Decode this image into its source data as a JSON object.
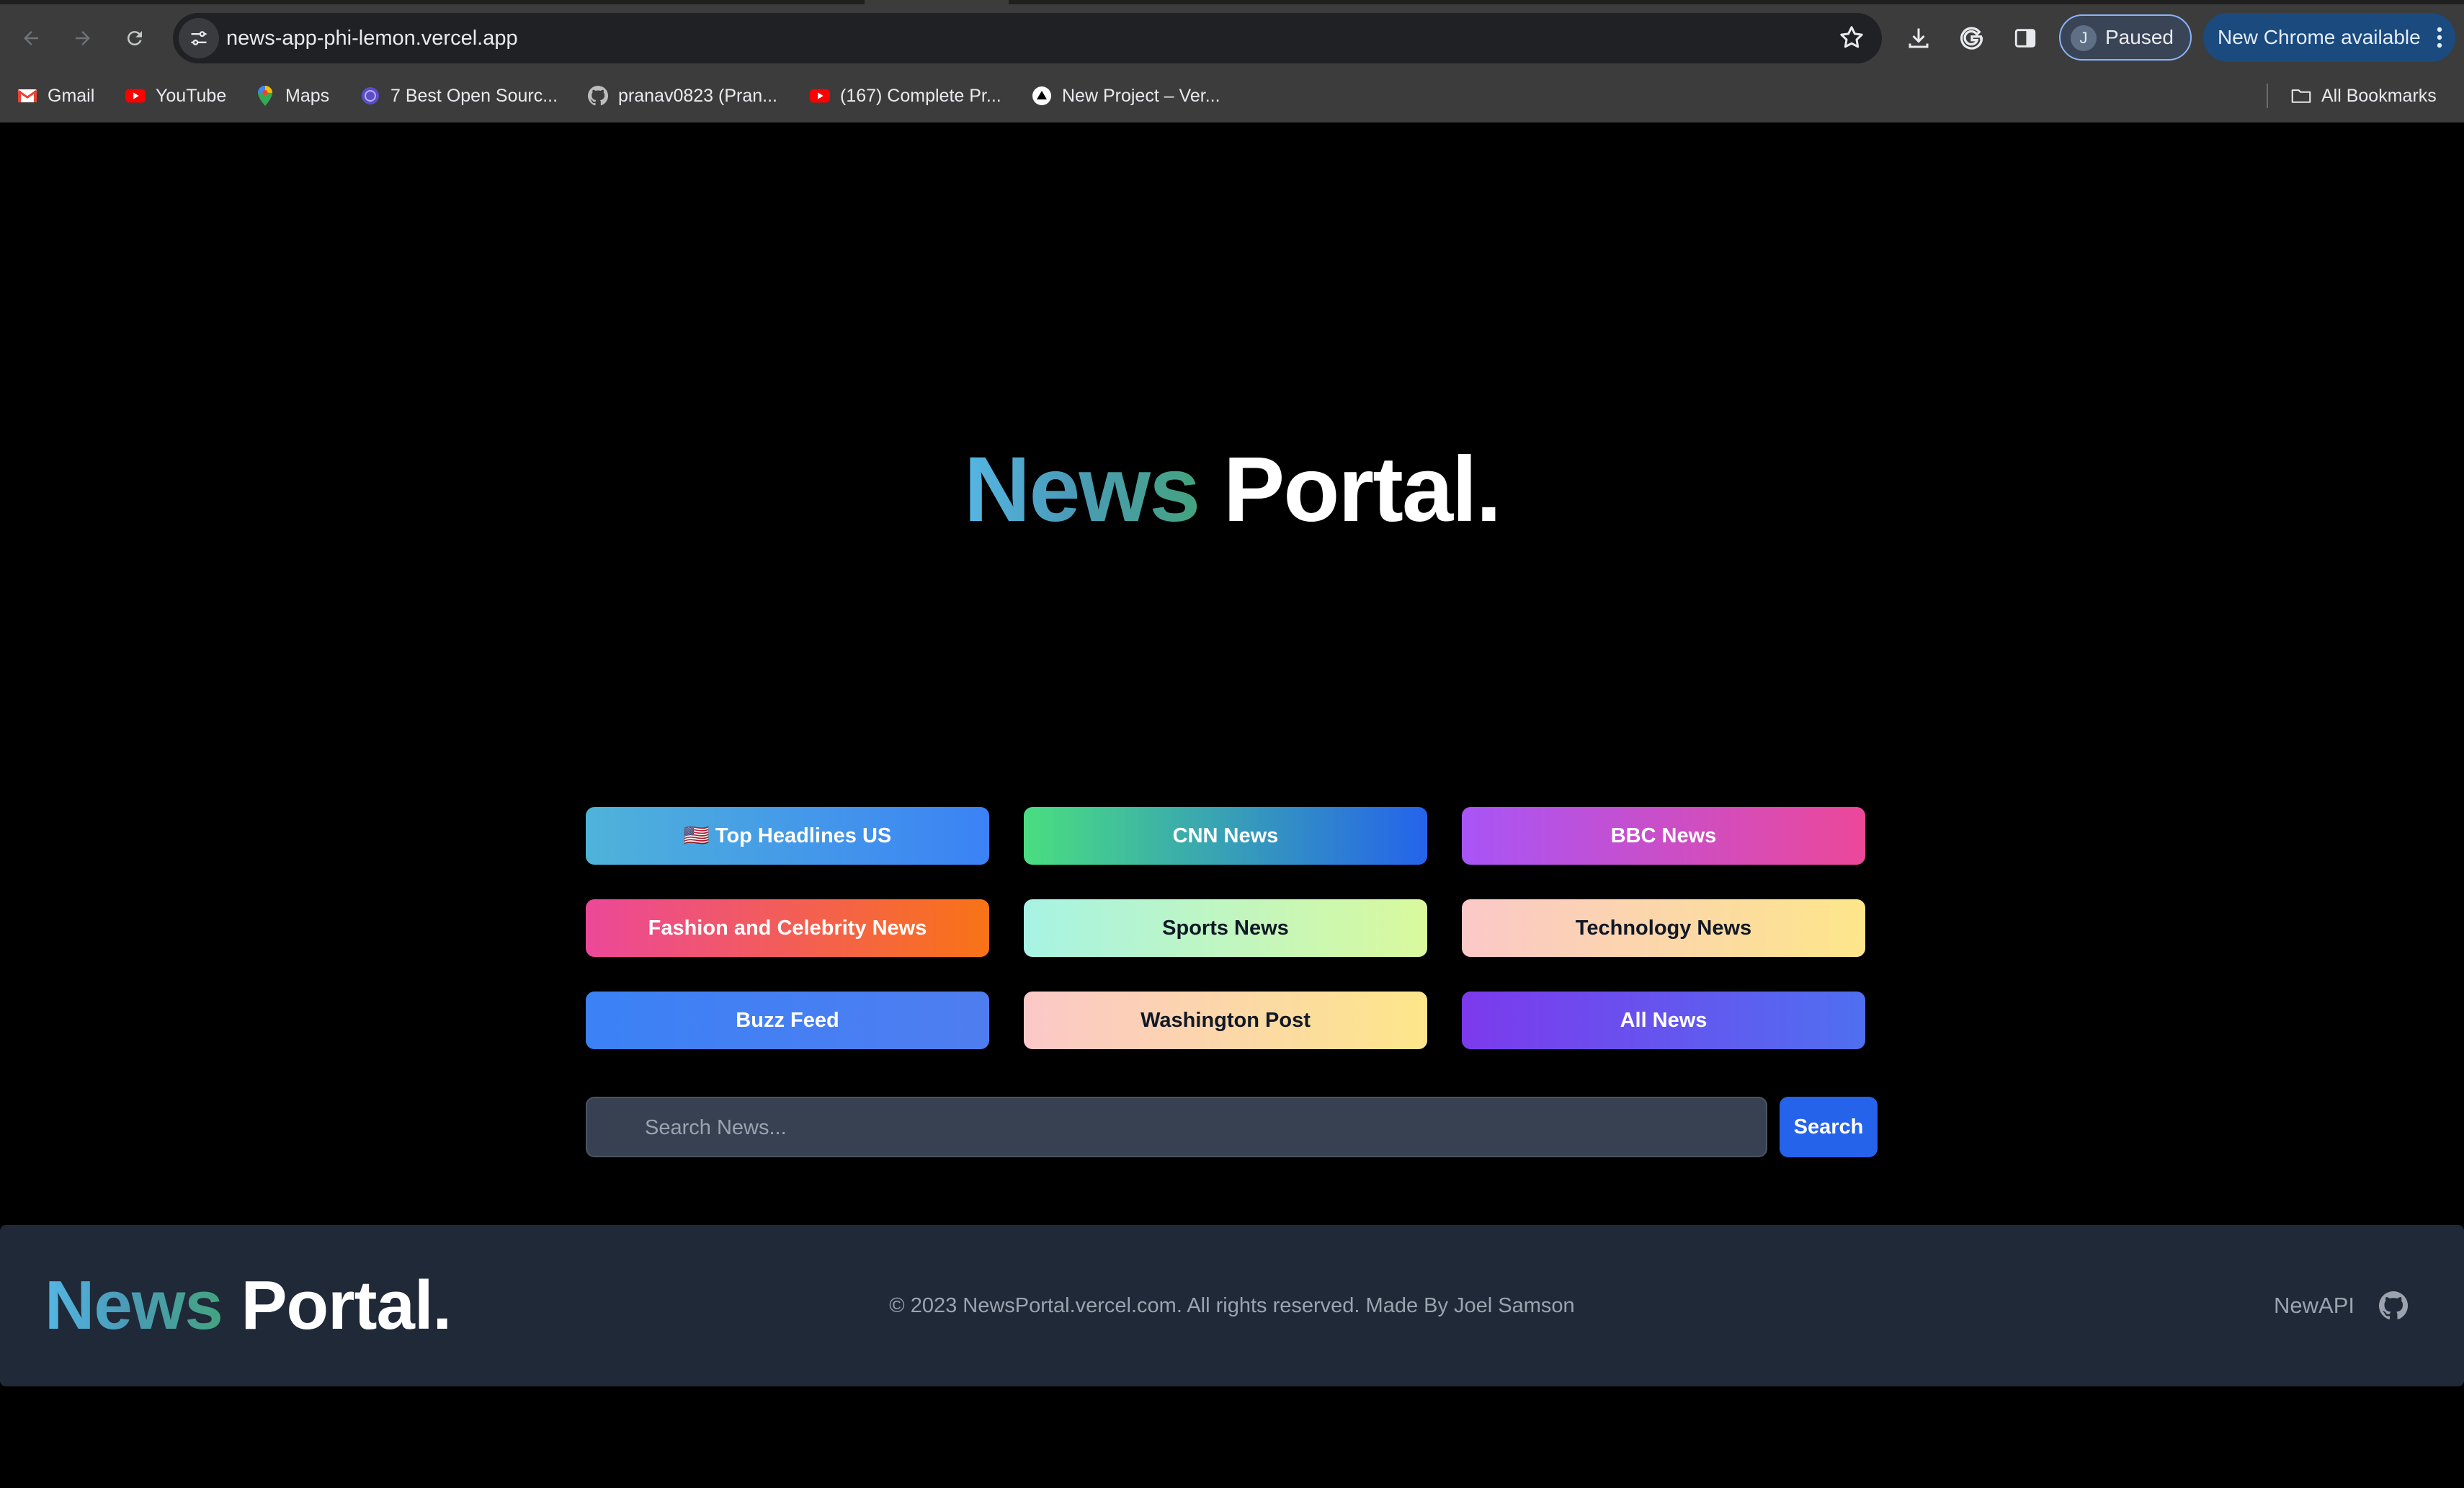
{
  "browser": {
    "url": "news-app-phi-lemon.vercel.app",
    "profile_initial": "J",
    "profile_status": "Paused",
    "update_label": "New Chrome available",
    "bookmarks": [
      {
        "label": "Gmail",
        "icon": "gmail-icon"
      },
      {
        "label": "YouTube",
        "icon": "youtube-icon"
      },
      {
        "label": "Maps",
        "icon": "maps-icon"
      },
      {
        "label": "7 Best Open Sourc...",
        "icon": "globe-icon"
      },
      {
        "label": "pranav0823 (Pran...",
        "icon": "github-icon"
      },
      {
        "label": "(167) Complete Pr...",
        "icon": "youtube-icon"
      },
      {
        "label": "New Project – Ver...",
        "icon": "vercel-icon"
      }
    ],
    "all_bookmarks_label": "All Bookmarks"
  },
  "hero": {
    "title_accent": "News",
    "title_rest": "Portal."
  },
  "categories": [
    {
      "label": "🇺🇸 Top Headlines US",
      "gradient": [
        "#4fb3d9",
        "#3b82f6"
      ],
      "text_color": "#ffffff"
    },
    {
      "label": "CNN News",
      "gradient": [
        "#4ade80",
        "#2563eb"
      ],
      "text_color": "#ffffff"
    },
    {
      "label": "BBC News",
      "gradient": [
        "#a855f7",
        "#ec4899"
      ],
      "text_color": "#ffffff"
    },
    {
      "label": "Fashion and Celebrity News",
      "gradient": [
        "#ec4899",
        "#f97316"
      ],
      "text_color": "#ffffff"
    },
    {
      "label": "Sports News",
      "gradient": [
        "#a7f3e4",
        "#d9f99d"
      ],
      "text_color": "#111827"
    },
    {
      "label": "Technology News",
      "gradient": [
        "#fbc8c8",
        "#fde68a"
      ],
      "text_color": "#111827"
    },
    {
      "label": "Buzz Feed",
      "gradient": [
        "#3b82f6",
        "#4f7df0"
      ],
      "text_color": "#ffffff"
    },
    {
      "label": "Washington Post",
      "gradient": [
        "#fbc8c8",
        "#fde68a"
      ],
      "text_color": "#111827"
    },
    {
      "label": "All News",
      "gradient": [
        "#7c3aed",
        "#4f6ff0"
      ],
      "text_color": "#ffffff"
    }
  ],
  "search": {
    "placeholder": "Search News...",
    "button_label": "Search"
  },
  "footer": {
    "title_accent": "News",
    "title_rest": "Portal.",
    "copyright": "© 2023 NewsPortal.vercel.com. All rights reserved. Made By Joel Samson",
    "api_link": "NewAPI"
  }
}
